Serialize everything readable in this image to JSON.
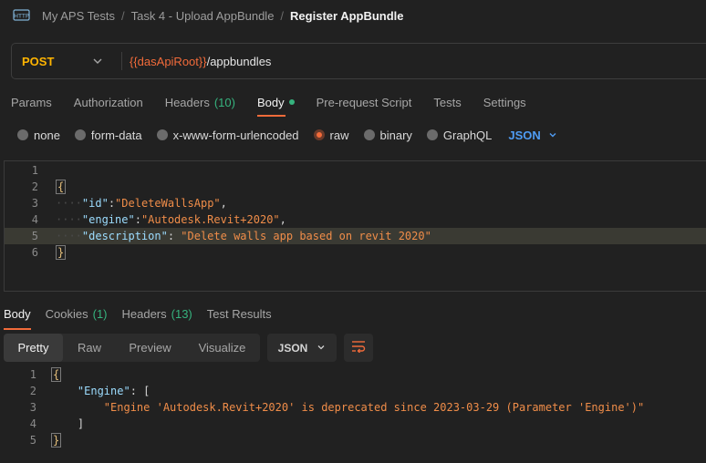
{
  "breadcrumb": {
    "icon": "http-icon",
    "items": [
      "My APS Tests",
      "Task 4 - Upload AppBundle"
    ],
    "separator": "/",
    "current": "Register AppBundle"
  },
  "request": {
    "method": "POST",
    "url_variable": "{{dasApiRoot}}",
    "url_path": "/appbundles"
  },
  "request_tabs": [
    {
      "label": "Params"
    },
    {
      "label": "Authorization"
    },
    {
      "label": "Headers",
      "count": "(10)"
    },
    {
      "label": "Body"
    },
    {
      "label": "Pre-request Script"
    },
    {
      "label": "Tests"
    },
    {
      "label": "Settings"
    }
  ],
  "body_types": [
    "none",
    "form-data",
    "x-www-form-urlencoded",
    "raw",
    "binary",
    "GraphQL"
  ],
  "body_format": "JSON",
  "request_code": {
    "line_numbers": [
      "1",
      "2",
      "3",
      "4",
      "5",
      "6"
    ],
    "open_brace": "{",
    "close_brace": "}",
    "pairs": [
      {
        "key": "\"id\"",
        "sep": ":",
        "value": "\"DeleteWallsApp\"",
        "end": ","
      },
      {
        "key": "\"engine\"",
        "sep": ":",
        "value": "\"Autodesk.Revit+2020\"",
        "end": ","
      },
      {
        "key": "\"description\"",
        "sep": ": ",
        "value": "\"Delete walls app based on revit 2020\"",
        "end": ""
      }
    ]
  },
  "response_tabs": [
    {
      "label": "Body"
    },
    {
      "label": "Cookies",
      "count": "(1)"
    },
    {
      "label": "Headers",
      "count": "(13)"
    },
    {
      "label": "Test Results"
    }
  ],
  "response_views": [
    "Pretty",
    "Raw",
    "Preview",
    "Visualize"
  ],
  "response_format": "JSON",
  "response_code": {
    "line_numbers": [
      "1",
      "2",
      "3",
      "4",
      "5"
    ],
    "open_brace": "{",
    "key": "\"Engine\"",
    "key_sep": ": [",
    "message": "\"Engine 'Autodesk.Revit+2020' is deprecated since 2023-03-29 (Parameter 'Engine')\"",
    "close_bracket": "]",
    "close_brace": "}"
  },
  "colors": {
    "accent": "#f26b3a",
    "method": "#ffb400",
    "count_green": "#36b37e",
    "json_blue": "#4f9cf3"
  }
}
